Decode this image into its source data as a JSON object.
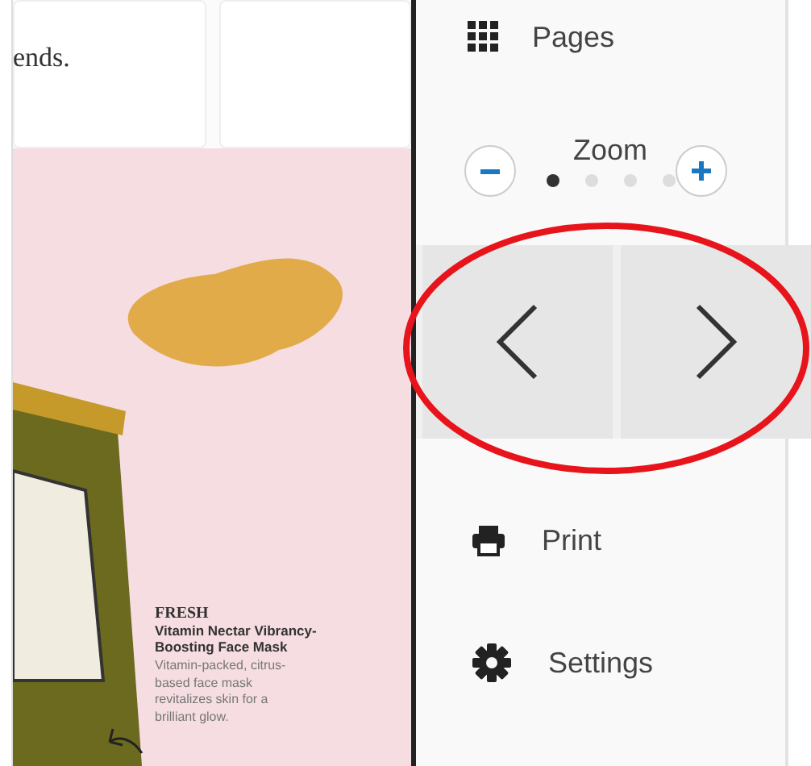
{
  "page": {
    "headline_fragment": "ends.",
    "product": {
      "brand": "FRESH",
      "name": "Vitamin Nectar Vibrancy-Boosting Face Mask",
      "description": "Vitamin-packed, citrus-based face mask revitalizes skin for a brilliant glow."
    }
  },
  "sidebar": {
    "pages": {
      "label": "Pages"
    },
    "zoom": {
      "label": "Zoom",
      "steps": [
        {
          "selected": true
        },
        {
          "selected": false
        },
        {
          "selected": false
        },
        {
          "selected": false
        }
      ]
    },
    "menu": [
      {
        "kind": "print",
        "label": "Print"
      },
      {
        "kind": "settings",
        "label": "Settings"
      }
    ]
  }
}
